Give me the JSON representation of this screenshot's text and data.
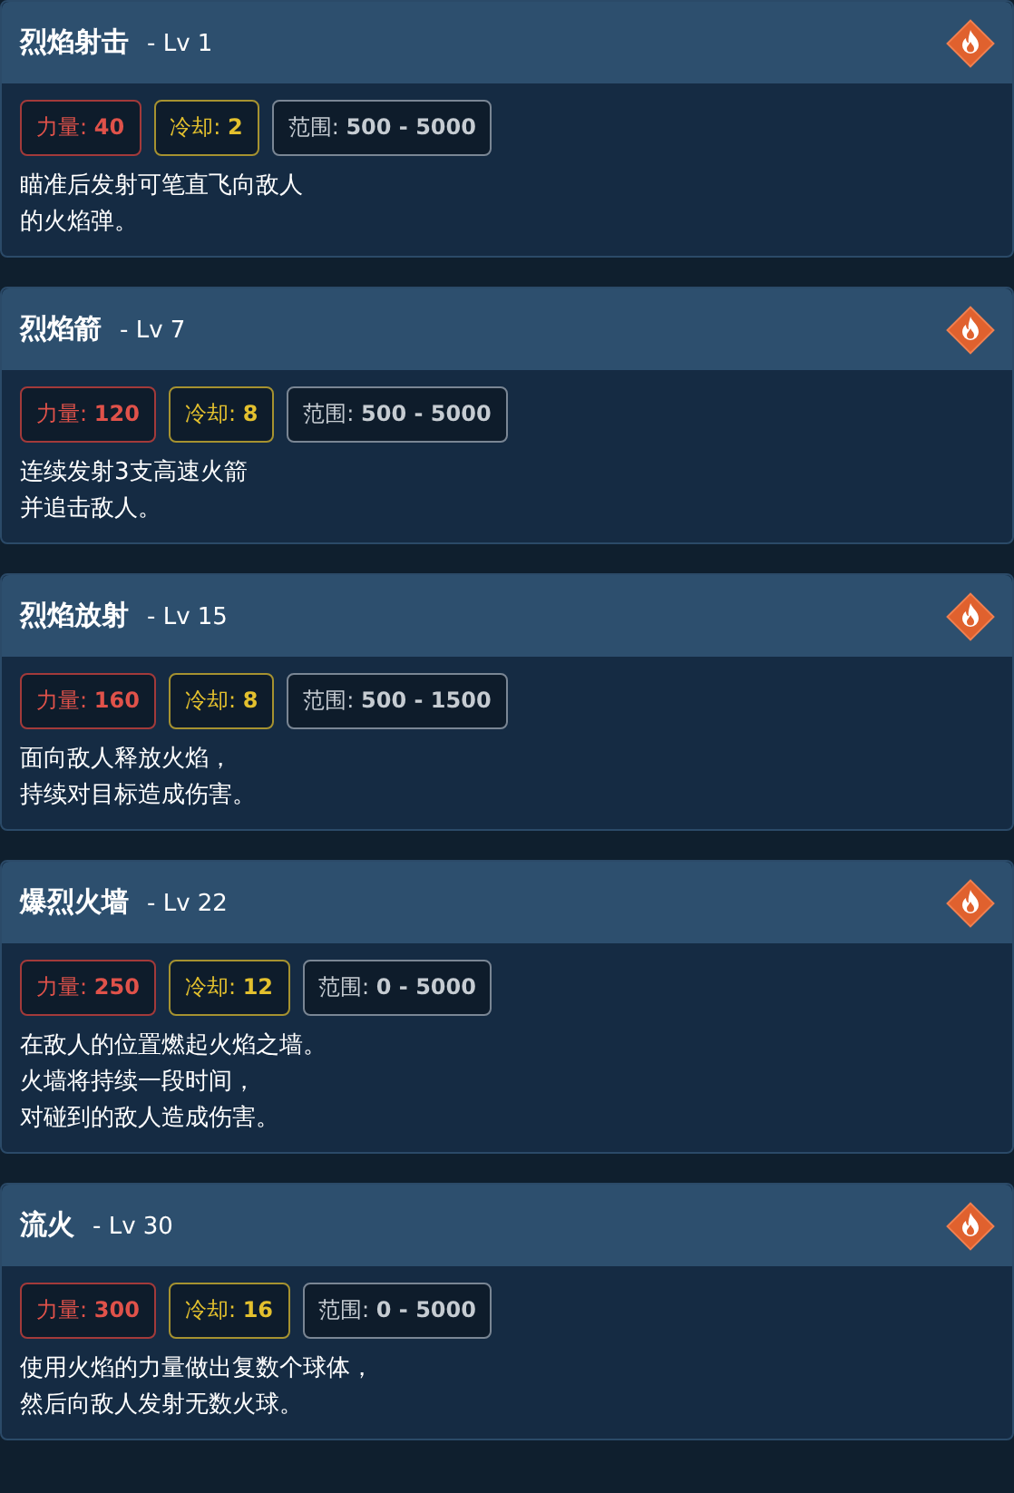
{
  "skills": [
    {
      "name": "烈焰射击",
      "level": "- Lv 1",
      "stats": [
        {
          "kind": "power",
          "label": "力量:",
          "value": "40"
        },
        {
          "kind": "cooldown",
          "label": "冷却:",
          "value": "2"
        },
        {
          "kind": "range",
          "label": "范围:",
          "value": "500 - 5000"
        }
      ],
      "description": [
        "瞄准后发射可笔直飞向敌人",
        "的火焰弹。"
      ]
    },
    {
      "name": "烈焰箭",
      "level": "- Lv 7",
      "stats": [
        {
          "kind": "power",
          "label": "力量:",
          "value": "120"
        },
        {
          "kind": "cooldown",
          "label": "冷却:",
          "value": "8"
        },
        {
          "kind": "range",
          "label": "范围:",
          "value": "500 - 5000"
        }
      ],
      "description": [
        "连续发射3支高速火箭",
        "并追击敌人。"
      ]
    },
    {
      "name": "烈焰放射",
      "level": "- Lv 15",
      "stats": [
        {
          "kind": "power",
          "label": "力量:",
          "value": "160"
        },
        {
          "kind": "cooldown",
          "label": "冷却:",
          "value": "8"
        },
        {
          "kind": "range",
          "label": "范围:",
          "value": "500 - 1500"
        }
      ],
      "description": [
        "面向敌人释放火焰，",
        "持续对目标造成伤害。"
      ]
    },
    {
      "name": "爆烈火墙",
      "level": "- Lv 22",
      "stats": [
        {
          "kind": "power",
          "label": "力量:",
          "value": "250"
        },
        {
          "kind": "cooldown",
          "label": "冷却:",
          "value": "12"
        },
        {
          "kind": "range",
          "label": "范围:",
          "value": "0 - 5000"
        }
      ],
      "description": [
        "在敌人的位置燃起火焰之墙。",
        "火墙将持续一段时间，",
        "对碰到的敌人造成伤害。"
      ]
    },
    {
      "name": "流火",
      "level": "- Lv 30",
      "stats": [
        {
          "kind": "power",
          "label": "力量:",
          "value": "300"
        },
        {
          "kind": "cooldown",
          "label": "冷却:",
          "value": "16"
        },
        {
          "kind": "range",
          "label": "范围:",
          "value": "0 - 5000"
        }
      ],
      "description": [
        "使用火焰的力量做出复数个球体，",
        "然后向敌人发射无数火球。"
      ]
    }
  ]
}
